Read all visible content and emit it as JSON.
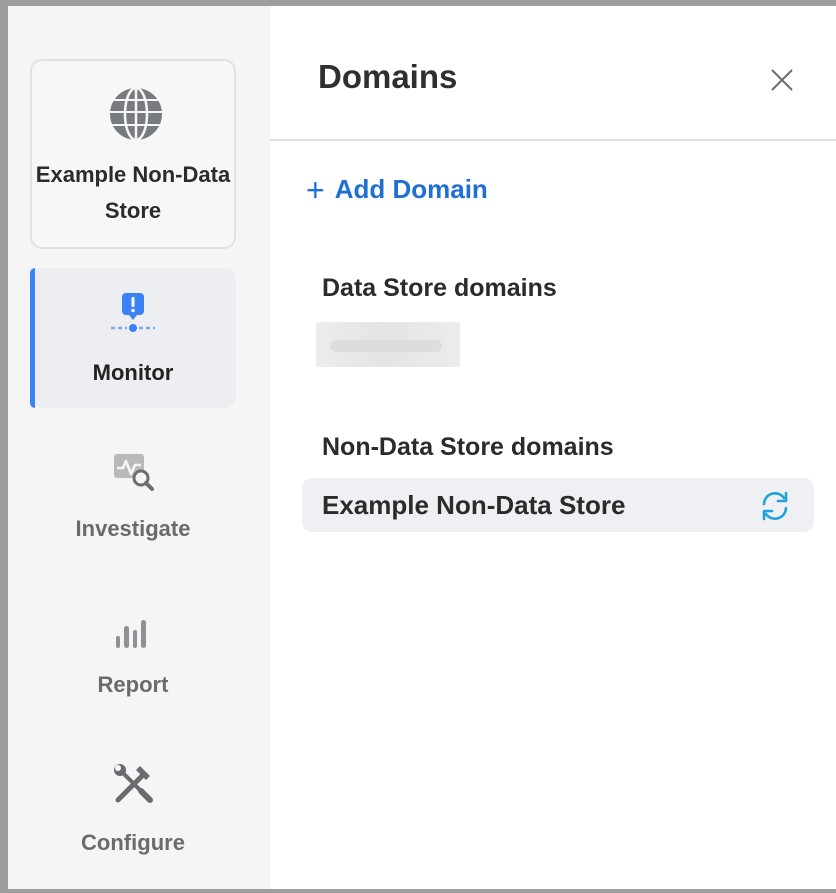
{
  "sidebar": {
    "domain_card": {
      "label": "Example Non-Data Store",
      "icon": "globe-icon"
    },
    "nav": [
      {
        "label": "Monitor",
        "icon": "monitor-alert-icon",
        "active": true
      },
      {
        "label": "Investigate",
        "icon": "investigate-icon",
        "active": false
      },
      {
        "label": "Report",
        "icon": "report-bars-icon",
        "active": false
      },
      {
        "label": "Configure",
        "icon": "configure-tools-icon",
        "active": false
      }
    ]
  },
  "panel": {
    "title": "Domains",
    "close_icon": "close-icon",
    "add_domain_label": "Add Domain",
    "data_store_section": {
      "title": "Data Store domains",
      "items": [
        {
          "label": "",
          "blurred": true
        }
      ]
    },
    "non_data_store_section": {
      "title": "Non-Data Store domains",
      "items": [
        {
          "label": "Example Non-Data Store",
          "icon": "sync-icon"
        }
      ]
    }
  },
  "colors": {
    "accent": "#1f6fd4",
    "active_indicator": "#3b82f6",
    "sync": "#1ea3dd",
    "sidebar_bg": "#f5f5f5"
  }
}
